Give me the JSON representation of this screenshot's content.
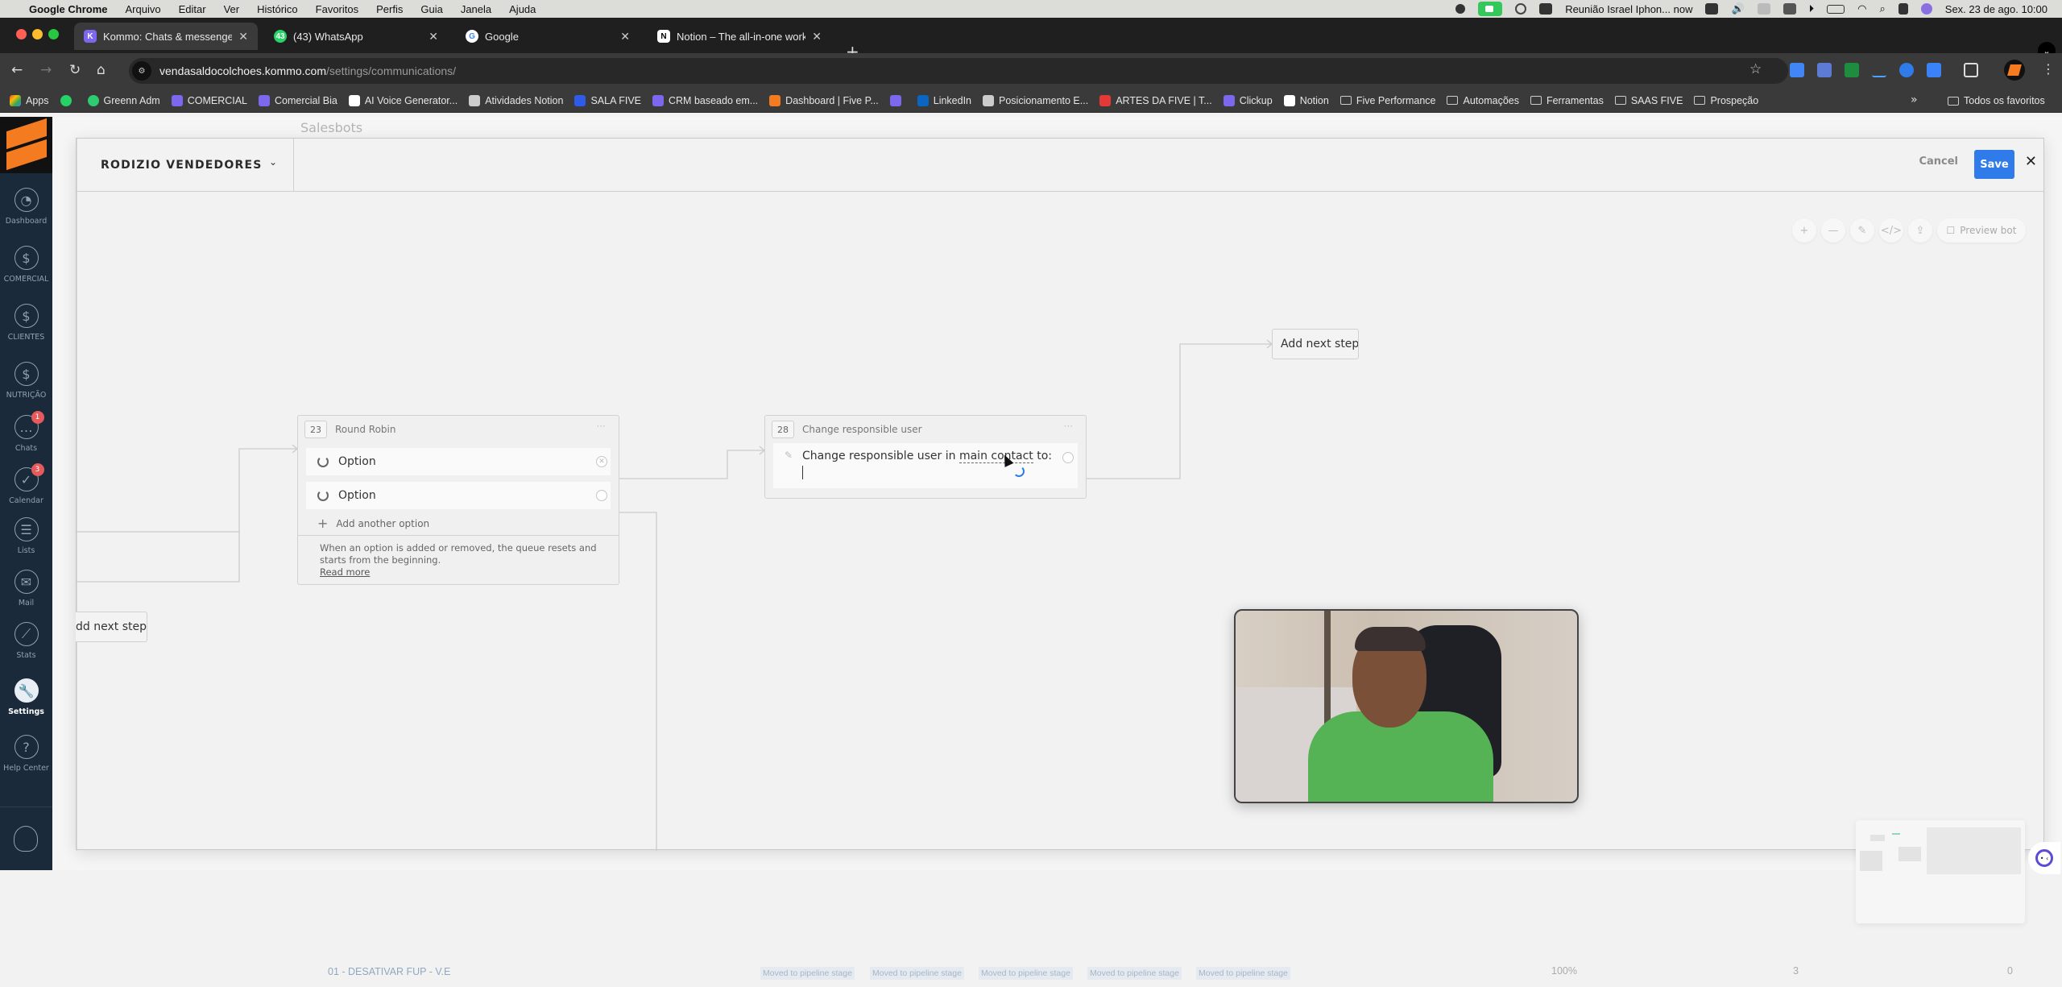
{
  "menubar": {
    "app_name": "Google Chrome",
    "menus": [
      "Arquivo",
      "Editar",
      "Ver",
      "Histórico",
      "Favoritos",
      "Perfis",
      "Guia",
      "Janela",
      "Ajuda"
    ],
    "notification": "Reunião Israel Iphon... now",
    "datetime": "Sex. 23 de ago.  10:00"
  },
  "tabs": [
    {
      "title": "Kommo: Chats & messengers",
      "icon": "kommo-icon",
      "active": true
    },
    {
      "title": "(43) WhatsApp",
      "icon": "whatsapp-icon",
      "active": false
    },
    {
      "title": "Google",
      "icon": "google-icon",
      "active": false
    },
    {
      "title": "Notion – The all-in-one works",
      "icon": "notion-icon",
      "active": false
    }
  ],
  "url": {
    "domain": "vendasaldocolchoes.kommo.com",
    "path": "/settings/communications/"
  },
  "bookmarks": [
    {
      "label": "Apps",
      "icon": "apps-grid-icon",
      "color": "#4285f4"
    },
    {
      "label": "",
      "icon": "whatsapp-icon",
      "color": "#25d366"
    },
    {
      "label": "Greenn Adm",
      "icon": "greenn-icon",
      "color": "#2ecc71"
    },
    {
      "label": "COMERCIAL",
      "icon": "kommo-icon",
      "color": "#7b68ee"
    },
    {
      "label": "Comercial Bia",
      "icon": "kommo-icon",
      "color": "#7b68ee"
    },
    {
      "label": "AI Voice Generator...",
      "icon": "ai-voice-icon",
      "color": "#ffffff"
    },
    {
      "label": "Atividades Notion",
      "icon": "checkbox-icon",
      "color": "#cccccc"
    },
    {
      "label": "SALA FIVE",
      "icon": "bluetooth-icon",
      "color": "#2f5bea"
    },
    {
      "label": "CRM baseado em...",
      "icon": "kommo-icon",
      "color": "#7b68ee"
    },
    {
      "label": "Dashboard | Five P...",
      "icon": "five-icon",
      "color": "#f47b20"
    },
    {
      "label": "",
      "icon": "kommo-icon",
      "color": "#7b68ee"
    },
    {
      "label": "LinkedIn",
      "icon": "linkedin-icon",
      "color": "#0a66c2"
    },
    {
      "label": "Posicionamento E...",
      "icon": "checkbox-icon",
      "color": "#cccccc"
    },
    {
      "label": "ARTES DA FIVE | T...",
      "icon": "artes-icon",
      "color": "#e53935"
    },
    {
      "label": "Clickup",
      "icon": "clickup-icon",
      "color": "#7b68ee"
    },
    {
      "label": "Notion",
      "icon": "notion-icon",
      "color": "#ffffff"
    },
    {
      "label": "Five Performance",
      "icon": "folder-icon",
      "color": ""
    },
    {
      "label": "Automações",
      "icon": "folder-icon",
      "color": ""
    },
    {
      "label": "Ferramentas",
      "icon": "folder-icon",
      "color": ""
    },
    {
      "label": "SAAS FIVE",
      "icon": "folder-icon",
      "color": ""
    },
    {
      "label": "Prospeção",
      "icon": "folder-icon",
      "color": ""
    }
  ],
  "bookmarks_all": "Todos os favoritos",
  "sidebar": {
    "items": [
      {
        "label": "Dashboard",
        "icon": "dashboard-gauge-icon",
        "badge": null,
        "active": false
      },
      {
        "label": "COMERCIAL",
        "icon": "money-bag-icon",
        "badge": null,
        "active": false
      },
      {
        "label": "CLIENTES",
        "icon": "money-bag-icon",
        "badge": null,
        "active": false
      },
      {
        "label": "NUTRIÇÃO",
        "icon": "money-bag-icon",
        "badge": null,
        "active": false
      },
      {
        "label": "Chats",
        "icon": "chat-bubble-icon",
        "badge": "1",
        "active": false
      },
      {
        "label": "Calendar",
        "icon": "check-circle-icon",
        "badge": "3",
        "active": false
      },
      {
        "label": "Lists",
        "icon": "list-icon",
        "badge": null,
        "active": false
      },
      {
        "label": "Mail",
        "icon": "mail-icon",
        "badge": null,
        "active": false
      },
      {
        "label": "Stats",
        "icon": "stats-chart-icon",
        "badge": null,
        "active": false
      },
      {
        "label": "Settings",
        "icon": "wrench-icon",
        "badge": null,
        "active": true
      },
      {
        "label": "Help Center",
        "icon": "help-question-icon",
        "badge": null,
        "active": false
      }
    ]
  },
  "page": {
    "breadcrumb": "Salesbots"
  },
  "editor": {
    "bot_name": "RODIZIO VENDEDORES",
    "cancel_label": "Cancel",
    "save_label": "Save",
    "save_color": "#2f7bea",
    "toolbar": {
      "zoom_in": "+",
      "zoom_out": "—",
      "magic": "✎",
      "code": "</>",
      "export": "⇪",
      "preview_label": "Preview bot"
    },
    "steps": {
      "round_robin": {
        "number": "23",
        "title": "Round Robin",
        "options": [
          "Option",
          "Option"
        ],
        "add_option_label": "Add another option",
        "note": "When an option is added or removed, the queue resets and starts from the beginning.",
        "read_more": "Read more"
      },
      "change_user": {
        "number": "28",
        "title": "Change responsible user",
        "text_prefix": "Change responsible user in ",
        "text_link": "main contact",
        "text_suffix": " to:"
      }
    },
    "add_next_step_right": "Add next step",
    "add_next_step_left": "dd next step"
  },
  "bottom_row": {
    "stage_name": "01 - DESATIVAR FUP - V.E",
    "tags": [
      "Moved to pipeline stage",
      "Moved to pipeline stage",
      "Moved to pipeline stage",
      "Moved to pipeline stage",
      "Moved to pipeline stage"
    ],
    "percent": "100%",
    "count_a": "3",
    "count_b": "0"
  }
}
